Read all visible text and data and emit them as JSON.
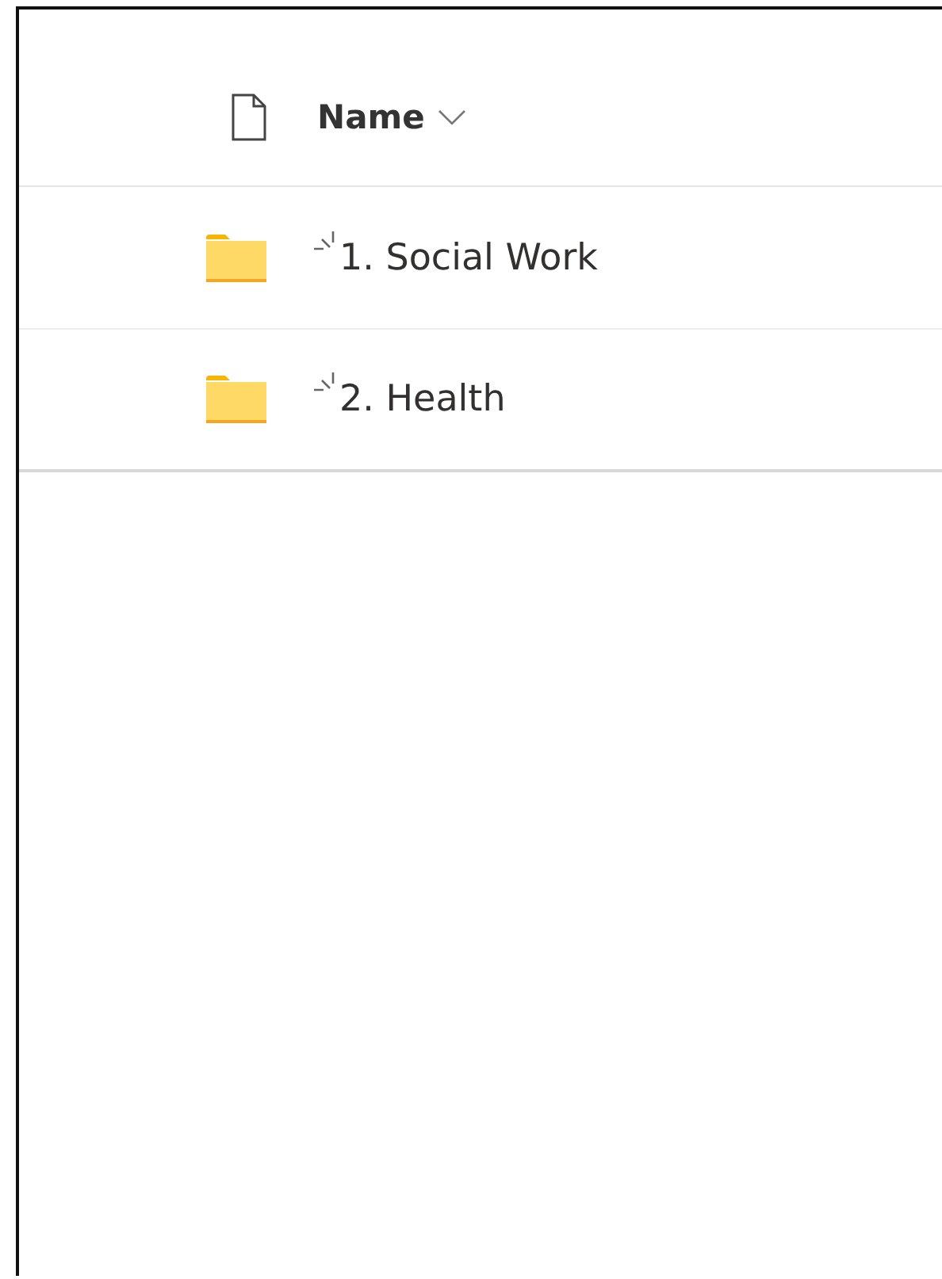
{
  "table": {
    "columns": [
      {
        "kind": "type"
      },
      {
        "kind": "name",
        "label": "Name"
      }
    ],
    "rows": [
      {
        "kind": "folder",
        "name": "1. Social Work",
        "new": true
      },
      {
        "kind": "folder",
        "name": "2. Health",
        "new": true
      }
    ]
  }
}
